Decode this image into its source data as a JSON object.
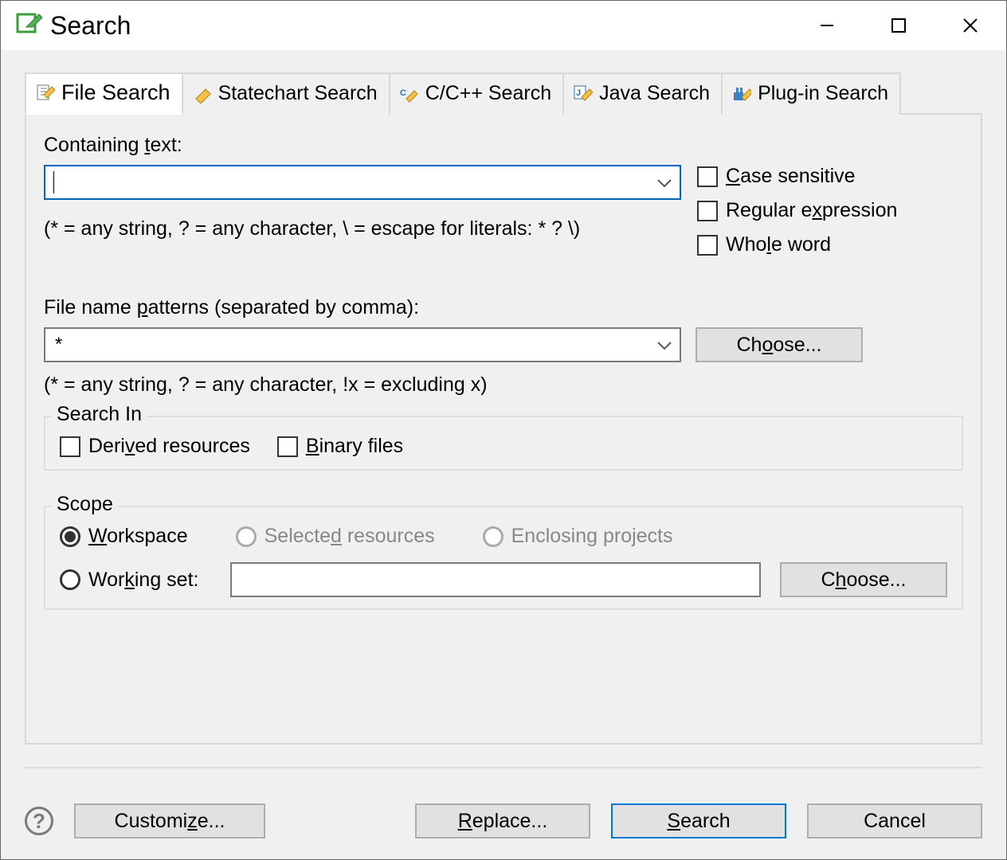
{
  "titlebar": {
    "title": "Search"
  },
  "tabs": [
    {
      "label": "File Search"
    },
    {
      "label": "Statechart Search"
    },
    {
      "label": "C/C++ Search"
    },
    {
      "label": "Java Search"
    },
    {
      "label": "Plug-in Search"
    }
  ],
  "containing": {
    "label": "Containing text:",
    "value": "",
    "hint": "(* = any string, ? = any character, \\ = escape for literals: * ? \\)"
  },
  "options": {
    "case_sensitive": "Case sensitive",
    "regex": "Regular expression",
    "whole_word": "Whole word"
  },
  "filename": {
    "label": "File name patterns (separated by comma):",
    "value": "*",
    "choose": "Choose...",
    "hint": "(* = any string, ? = any character, !x = excluding x)"
  },
  "search_in": {
    "title": "Search In",
    "derived": "Derived resources",
    "binary": "Binary files"
  },
  "scope": {
    "title": "Scope",
    "workspace": "Workspace",
    "selected_resources": "Selected resources",
    "enclosing_projects": "Enclosing projects",
    "working_set": "Working set:",
    "choose": "Choose..."
  },
  "footer": {
    "customize": "Customize...",
    "replace": "Replace...",
    "search": "Search",
    "cancel": "Cancel"
  }
}
